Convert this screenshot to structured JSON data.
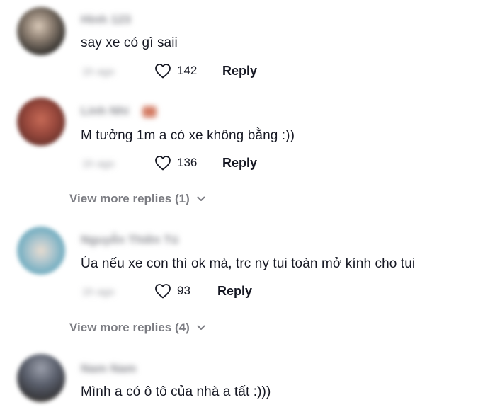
{
  "comments": [
    {
      "username": "Hình 123",
      "text": "say xe có gì saii",
      "date": "1h ago",
      "likes": "142",
      "reply_label": "Reply"
    },
    {
      "username": "Linh Nhi",
      "text": "M tưởng 1m a có xe không bằng :))",
      "date": "1h ago",
      "likes": "136",
      "reply_label": "Reply"
    },
    {
      "username": "Nguyễn Thiên Tú",
      "text": "Úa nếu xe con thì ok mà, trc ny tui toàn mở kính cho tui",
      "date": "1h ago",
      "likes": "93",
      "reply_label": "Reply"
    },
    {
      "username": "Nam Nam",
      "text": "Mình a có ô tô của nhà a tất :)))"
    }
  ],
  "view_more_1": "View more replies (1)",
  "view_more_2": "View more replies (4)",
  "colors": {
    "text": "#161823",
    "secondary": "#7c7d83",
    "background": "#ffffff"
  }
}
